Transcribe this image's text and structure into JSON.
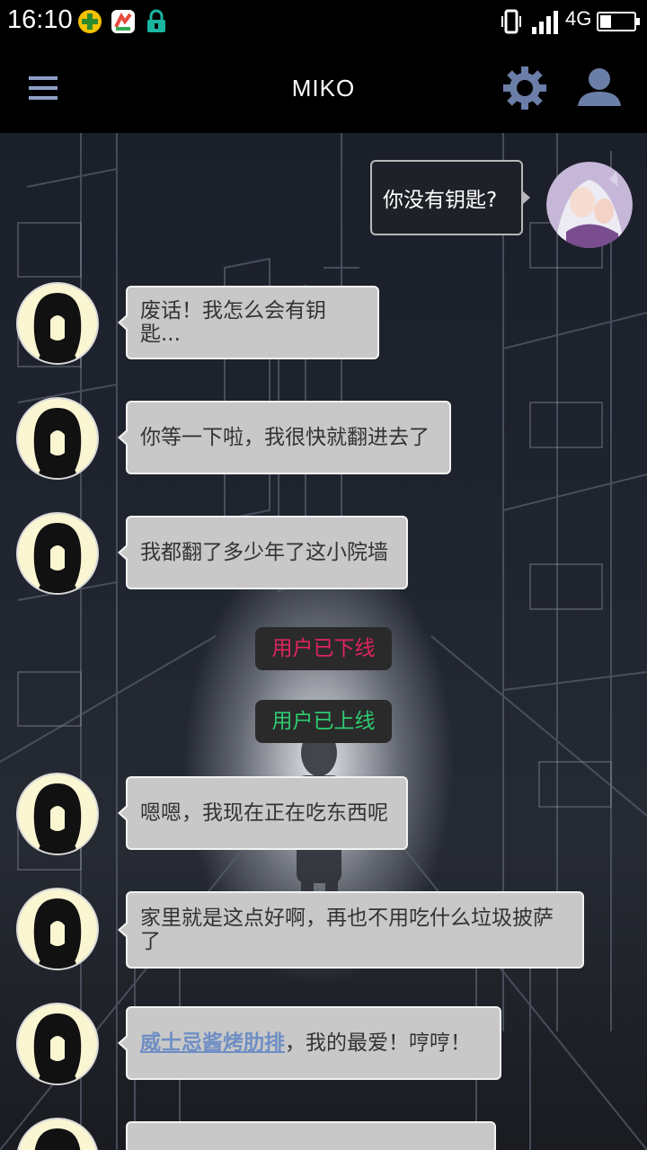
{
  "status_bar": {
    "time": "16:10",
    "network": "4G",
    "icons": [
      "app-plus-icon",
      "app-market-icon",
      "lock-icon",
      "vibrate-icon",
      "signal-icon",
      "battery-icon"
    ]
  },
  "app_bar": {
    "title": "MIKO",
    "icons": [
      "menu-icon",
      "settings-gear-icon",
      "profile-icon"
    ]
  },
  "messages": [
    {
      "from": "user",
      "text": "你没有钥匙?"
    },
    {
      "from": "miko",
      "text": "废话！我怎么会有钥匙..."
    },
    {
      "from": "miko",
      "text": "你等一下啦，我很快就翻进去了"
    },
    {
      "from": "miko",
      "text": "我都翻了多少年了这小院墙"
    },
    {
      "from": "system",
      "text": "用户已下线",
      "color": "#e0245e"
    },
    {
      "from": "system",
      "text": "用户已上线",
      "color": "#2ecc71"
    },
    {
      "from": "miko",
      "text": "嗯嗯，我现在正在吃东西呢"
    },
    {
      "from": "miko",
      "text": "家里就是这点好啊，再也不用吃什么垃圾披萨了"
    },
    {
      "from": "miko",
      "link_text": "威士忌酱烤肋排",
      "text": "，我的最爱！哼哼！"
    }
  ],
  "colors": {
    "bubble_left": "#c8c8c8",
    "bubble_right": "#1e2128",
    "offline": "#e0245e",
    "online": "#2ecc71",
    "link": "#6f8ec4"
  }
}
